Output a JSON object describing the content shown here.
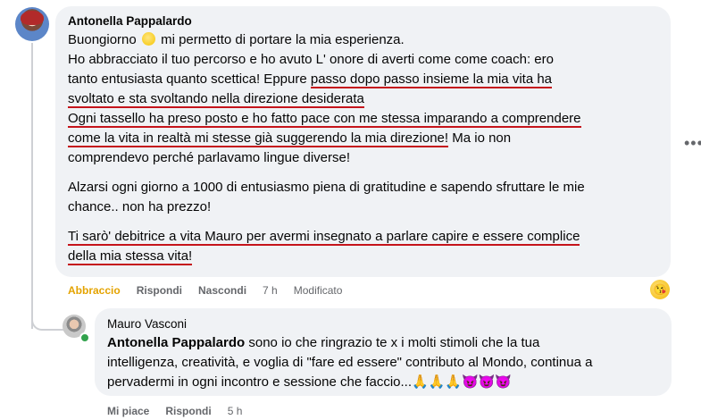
{
  "comment": {
    "author": "Antonella Pappalardo",
    "lines": [
      {
        "pre": "Buongiorno ",
        "emoji": "sun",
        "post": " mi permetto di portare la mia esperienza."
      },
      "Ho abbracciato il tuo percorso e ho avuto L' onore di averti come come coach: ero",
      "tanto entusiasta quanto scettica! Eppure ",
      "passo dopo passo insieme la mia vita ha",
      "svoltato e sta svoltando nella direzione desiderata",
      "Ogni tassello ha preso posto e ho fatto pace con me stessa imparando a comprendere",
      "come la vita in realtà mi stesse già suggerendo la mia direzione!",
      " Ma io non",
      "comprendevo perché parlavamo lingue diverse!",
      "Alzarsi ogni giorno a 1000 di entusiasmo piena di gratitudine e sapendo sfruttare le mie",
      "chance.. non ha prezzo!",
      "Ti sarò' debitrice a vita Mauro per avermi insegnato a parlare capire e essere complice",
      "della mia stessa vita!"
    ],
    "actions": {
      "like": "Abbraccio",
      "reply": "Rispondi",
      "hide": "Nascondi",
      "time": "7 h",
      "edited": "Modificato"
    },
    "more_icon": "more-horizontal-icon",
    "reaction_icon": "smiling-face-emoji"
  },
  "reply": {
    "author": "Mauro Vasconi",
    "mention": "Antonella Pappalardo",
    "lines": [
      " sono io che ringrazio te x i molti stimoli che la tua",
      "intelligenza, creatività, e voglia di \"fare ed essere\" contributo al Mondo, continua a",
      "pervadermi in ogni incontro e sessione che faccio..."
    ],
    "emojis": "🙏🙏🙏😈😈😈",
    "actions": {
      "like": "Mi piace",
      "reply": "Rispondi",
      "time": "5 h"
    }
  },
  "colors": {
    "bubble": "#f0f2f5",
    "underline": "#c5141b",
    "meta": "#65676b",
    "reaction_active": "#e4a300"
  }
}
